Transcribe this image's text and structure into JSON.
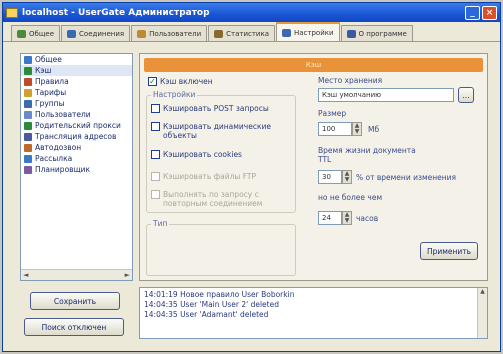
{
  "window": {
    "title": "localhost - UserGate Администратор"
  },
  "tabs": [
    {
      "label": "Общее",
      "color": "#4a8a3c"
    },
    {
      "label": "Соединения",
      "color": "#3c6ab0"
    },
    {
      "label": "Пользователи",
      "color": "#c08a30"
    },
    {
      "label": "Статистика",
      "color": "#8a6a2a"
    },
    {
      "label": "Настройки",
      "color": "#3c6ab0"
    },
    {
      "label": "О программе",
      "color": "#3a5aa0"
    }
  ],
  "nav": {
    "items": [
      {
        "label": "Общее",
        "color": "#3a78c8"
      },
      {
        "label": "Кэш",
        "color": "#2c8a3c"
      },
      {
        "label": "Правила",
        "color": "#c04a2a"
      },
      {
        "label": "Тарифы",
        "color": "#d0a030"
      },
      {
        "label": "Группы",
        "color": "#3c6ab0"
      },
      {
        "label": "Пользователи",
        "color": "#6a8ac8"
      },
      {
        "label": "Родительский прокси",
        "color": "#2c8a3c"
      },
      {
        "label": "Трансляция адресов",
        "color": "#4a5aa0"
      },
      {
        "label": "Автодозвон",
        "color": "#c06a2a"
      },
      {
        "label": "Рассылка",
        "color": "#3a78c8"
      },
      {
        "label": "Планировщик",
        "color": "#7a5aa0"
      }
    ]
  },
  "content": {
    "band_label": "Кэш",
    "cache_enable": "Кэш включен",
    "settings_group": "Настройки",
    "opt_post": "Кэшировать POST запросы",
    "opt_dynamic": "Кэшировать динамические объекты",
    "opt_cookies": "Кэшировать cookies",
    "opt_ftp": "Кэшировать файлы FTP",
    "opt_reconnect": "Выполнять по запросу с повторным соединением",
    "type_group": "Тип",
    "storage_label": "Место хранения",
    "storage_value": "Кэш умолчанию",
    "browse_label": "...",
    "size_label": "Размер",
    "size_value": "100",
    "size_unit": "Мб",
    "ttl_label": "Время жизни документа TTL",
    "ttl_percent_value": "30",
    "ttl_percent_text": "% от времени изменения",
    "not_more_text": "но не более чем",
    "hours_value": "24",
    "hours_unit": "часов",
    "apply_label": "Применить"
  },
  "bottom": {
    "save_label": "Сохранить",
    "stop_label": "Поиск отключен"
  },
  "log": [
    "14:01:19 Новое правило User Boborkin",
    "14:04:35 User 'Main User 2' deleted",
    "14:04:35 User 'Adamant' deleted"
  ]
}
